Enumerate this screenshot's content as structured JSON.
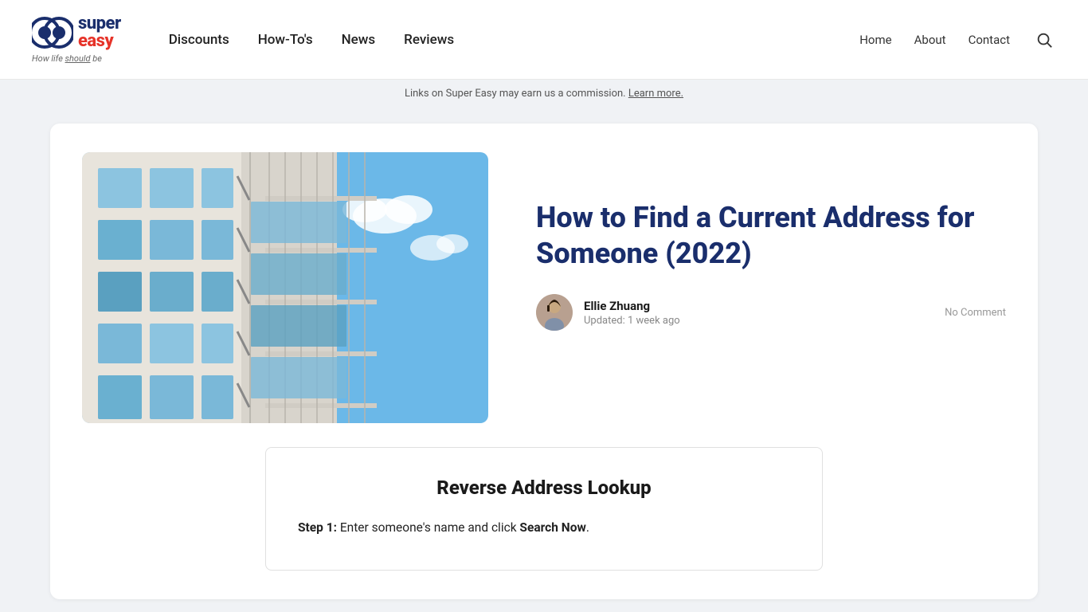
{
  "header": {
    "logo": {
      "brand1": "super",
      "brand2": "easy",
      "tagline": "How life should be",
      "tagline_underline": "should"
    },
    "nav_main": [
      {
        "label": "Discounts",
        "href": "#"
      },
      {
        "label": "How-To's",
        "href": "#"
      },
      {
        "label": "News",
        "href": "#"
      },
      {
        "label": "Reviews",
        "href": "#"
      }
    ],
    "nav_right": [
      {
        "label": "Home",
        "href": "#"
      },
      {
        "label": "About",
        "href": "#"
      },
      {
        "label": "Contact",
        "href": "#"
      }
    ]
  },
  "notice": {
    "text": "Links on Super Easy may earn us a commission.",
    "link_text": "Learn more."
  },
  "article": {
    "title": "How to Find a Current Address for Someone (2022)",
    "author_name": "Ellie Zhuang",
    "updated": "Updated: 1 week ago",
    "no_comment": "No Comment"
  },
  "lookup_box": {
    "title": "Reverse Address Lookup",
    "step1_label": "Step 1:",
    "step1_text": " Enter someone's name and click ",
    "step1_cta": "Search Now",
    "step1_end": "."
  }
}
